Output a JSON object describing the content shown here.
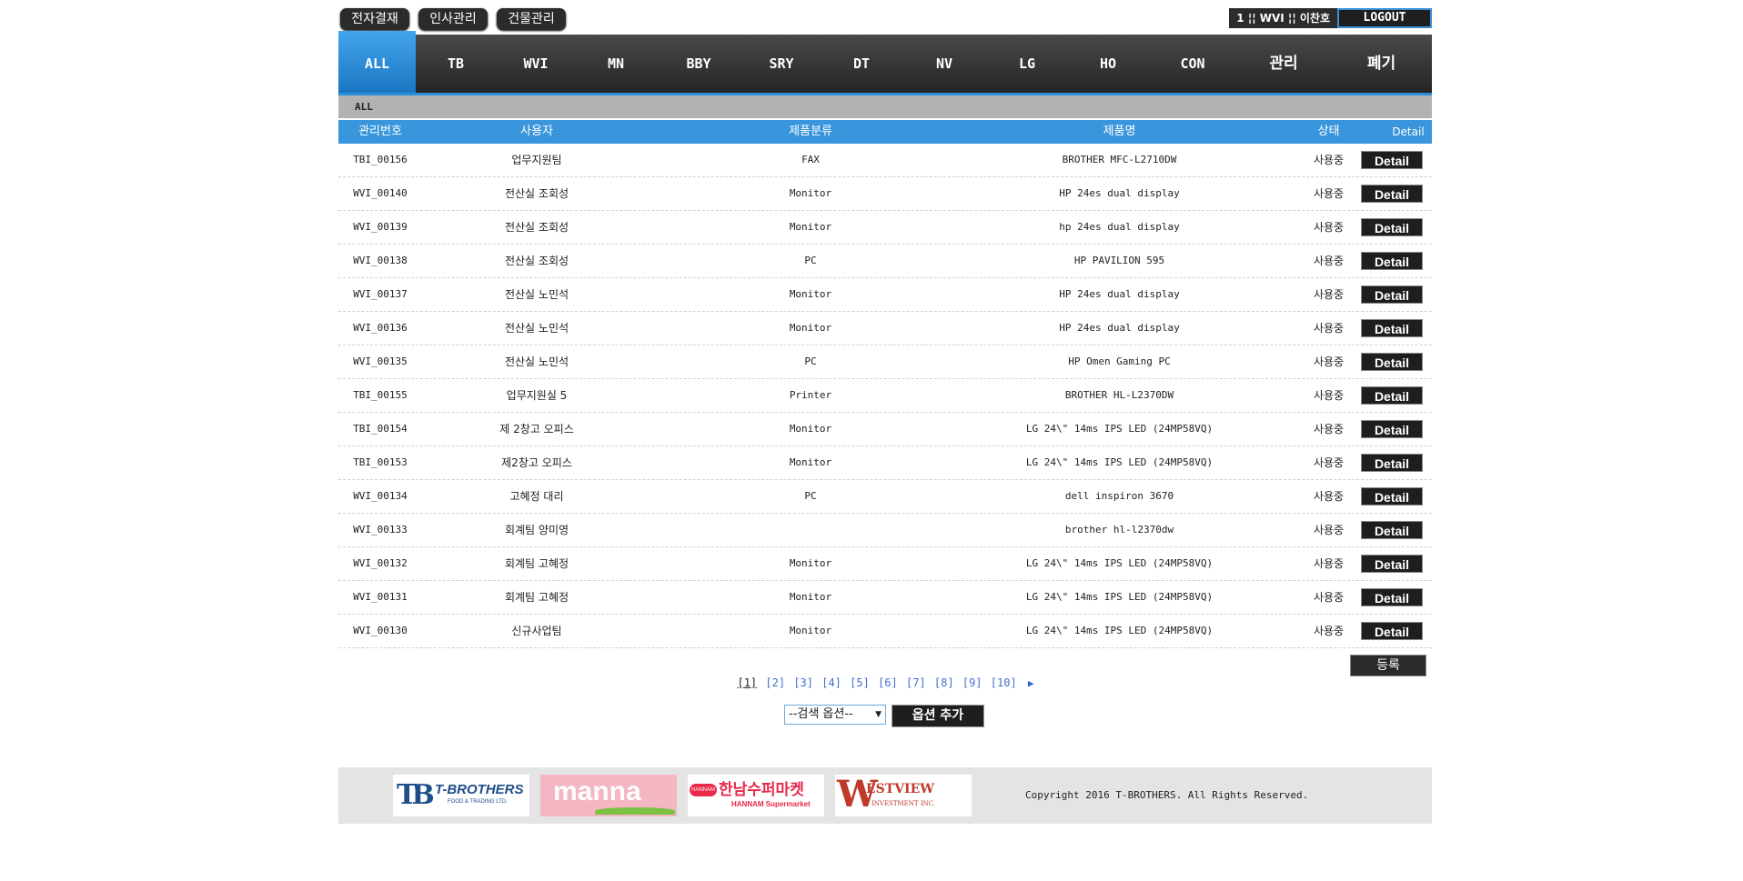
{
  "top_buttons": [
    "전자결재",
    "인사관리",
    "건물관리"
  ],
  "user": {
    "info": "1 ¦¦ WVI ¦¦ 이찬호",
    "logout": "LOGOUT"
  },
  "nav": [
    "ALL",
    "TB",
    "WVI",
    "MN",
    "BBY",
    "SRY",
    "DT",
    "NV",
    "LG",
    "HO",
    "CON",
    "관리",
    "폐기"
  ],
  "breadcrumb": "ALL",
  "table": {
    "headers": [
      "관리번호",
      "사용자",
      "제품분류",
      "제품명",
      "상태",
      "Detail"
    ],
    "rows": [
      [
        "TBI_00156",
        "업무지원팀",
        "FAX",
        "BROTHER MFC-L2710DW",
        "사용중"
      ],
      [
        "WVI_00140",
        "전산실 조회성",
        "Monitor",
        "HP 24es dual display",
        "사용중"
      ],
      [
        "WVI_00139",
        "전산실 조회성",
        "Monitor",
        "hp 24es dual display",
        "사용중"
      ],
      [
        "WVI_00138",
        "전산실 조회성",
        "PC",
        "HP PAVILION 595",
        "사용중"
      ],
      [
        "WVI_00137",
        "전산실 노민석",
        "Monitor",
        "HP 24es dual display",
        "사용중"
      ],
      [
        "WVI_00136",
        "전산실 노민석",
        "Monitor",
        "HP 24es dual display",
        "사용중"
      ],
      [
        "WVI_00135",
        "전산실 노민석",
        "PC",
        "HP Omen Gaming PC",
        "사용중"
      ],
      [
        "TBI_00155",
        "업무지원실 5",
        "Printer",
        "BROTHER HL-L2370DW",
        "사용중"
      ],
      [
        "TBI_00154",
        "제 2창고 오피스",
        "Monitor",
        "LG 24\\\" 14ms IPS LED (24MP58VQ)",
        "사용중"
      ],
      [
        "TBI_00153",
        "제2창고 오피스",
        "Monitor",
        "LG 24\\\" 14ms IPS LED (24MP58VQ)",
        "사용중"
      ],
      [
        "WVI_00134",
        "고혜정 대리",
        "PC",
        "dell inspiron 3670",
        "사용중"
      ],
      [
        "WVI_00133",
        "회계팀 양미영",
        "",
        "brother hl-l2370dw",
        "사용중"
      ],
      [
        "WVI_00132",
        "회계팀 고혜정",
        "Monitor",
        "LG 24\\\" 14ms IPS LED (24MP58VQ)",
        "사용중"
      ],
      [
        "WVI_00131",
        "회계팀 고혜정",
        "Monitor",
        "LG 24\\\" 14ms IPS LED (24MP58VQ)",
        "사용중"
      ],
      [
        "WVI_00130",
        "신규사업팀",
        "Monitor",
        "LG 24\\\" 14ms IPS LED (24MP58VQ)",
        "사용중"
      ]
    ],
    "detail_label": "Detail"
  },
  "register_label": "등록",
  "pagination": {
    "pages": [
      "[1]",
      "[2]",
      "[3]",
      "[4]",
      "[5]",
      "[6]",
      "[7]",
      "[8]",
      "[9]",
      "[10]"
    ],
    "current": "[1]",
    "next_icon": "play-arrow-icon"
  },
  "search": {
    "select_value": "--검색 옵션--",
    "add_option_label": "옵션 추가"
  },
  "footer": {
    "logos": {
      "tbrothers": {
        "mark": "TB",
        "name": "T-BROTHERS",
        "sub": "FOOD & TRADING LTD."
      },
      "manna": {
        "name": "manna"
      },
      "hannam": {
        "badge": "HANNAM",
        "name": "한남수퍼마켓",
        "sub": "HANNAM Supermarket"
      },
      "westview": {
        "mark": "W",
        "name": "ESTVIEW",
        "sub": "INVESTMENT INC."
      }
    },
    "copyright": "Copyright 2016 T-BROTHERS. All Rights Reserved."
  },
  "colors": {
    "accent": "#3a96dc",
    "nav_dark": "#2b2b2b",
    "breadcrumb": "#b2b2b2",
    "footer": "#e4e4e4"
  }
}
